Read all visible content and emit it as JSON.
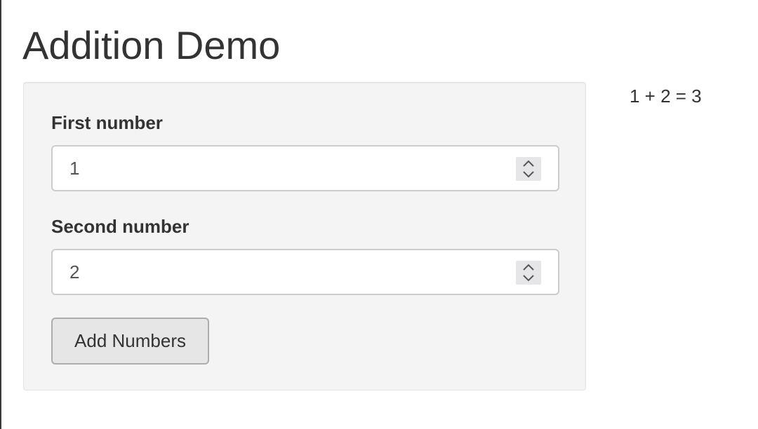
{
  "page": {
    "title": "Addition Demo"
  },
  "form": {
    "first": {
      "label": "First number",
      "value": "1"
    },
    "second": {
      "label": "Second number",
      "value": "2"
    },
    "button_label": "Add Numbers"
  },
  "output": {
    "result_text": "1 + 2 = 3"
  },
  "colors": {
    "panel_background": "#f4f4f4",
    "button_background": "#e6e6e6",
    "text": "#333333"
  }
}
